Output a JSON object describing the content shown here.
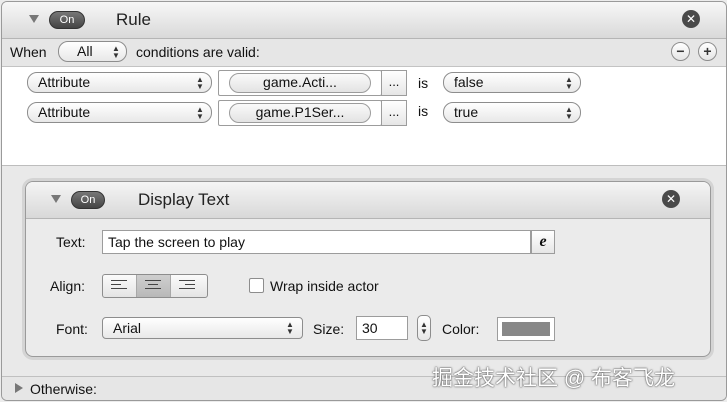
{
  "rule": {
    "title": "Rule",
    "on_label": "On",
    "close_glyph": "✕",
    "when_label": "When",
    "match_mode": "All",
    "conditions_text": "conditions are valid:",
    "remove_glyph": "−",
    "add_glyph": "+",
    "conditions": [
      {
        "type": "Attribute",
        "attribute": "game.Acti...",
        "ellipsis": "...",
        "operator": "is",
        "value": "false"
      },
      {
        "type": "Attribute",
        "attribute": "game.P1Ser...",
        "ellipsis": "...",
        "operator": "is",
        "value": "true"
      }
    ],
    "otherwise_label": "Otherwise:"
  },
  "display_text": {
    "title": "Display Text",
    "on_label": "On",
    "close_glyph": "✕",
    "text_label": "Text:",
    "text_value": "Tap the screen to play",
    "expression_glyph": "e",
    "align_label": "Align:",
    "align_options": [
      "left",
      "center",
      "right"
    ],
    "align_selected": "center",
    "wrap_label": "Wrap inside actor",
    "wrap_checked": false,
    "font_label": "Font:",
    "font_value": "Arial",
    "size_label": "Size:",
    "size_value": "30",
    "color_label": "Color:",
    "color_value": "#888888"
  },
  "watermark": "掘金技术社区 @ 布客飞龙",
  "icons": {
    "collapse": "triangle-down-icon",
    "expand": "triangle-right-icon",
    "close": "close-icon",
    "expression": "expression-editor-icon"
  }
}
